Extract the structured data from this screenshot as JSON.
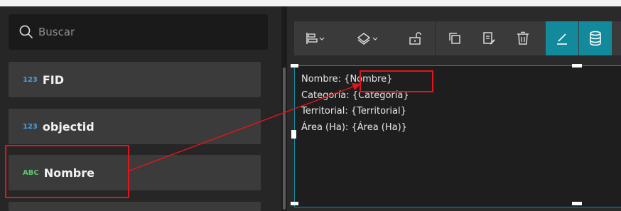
{
  "search": {
    "placeholder": "Buscar"
  },
  "fields": [
    {
      "type_label": "123",
      "name": "FID"
    },
    {
      "type_label": "123",
      "name": "objectid"
    },
    {
      "type_label": "ABC",
      "name": "Nombre"
    }
  ],
  "toolbar": {
    "buttons": [
      "align-icon",
      "layers-icon",
      "unlock-icon",
      "duplicate-icon",
      "edit-document-icon",
      "trash-icon",
      "pencil-icon",
      "database-icon"
    ]
  },
  "editor": {
    "lines": [
      {
        "label": "Nombre:",
        "value": "{Nombre}"
      },
      {
        "label": "Categoría:",
        "value": "{Categoría}"
      },
      {
        "label": "Territorial:",
        "value": "{Territorial}"
      },
      {
        "label": "Área (Ha):",
        "value": "{Área (Ha)}"
      }
    ]
  },
  "colors": {
    "accent": "#138a9b",
    "highlight": "#e3141b"
  }
}
